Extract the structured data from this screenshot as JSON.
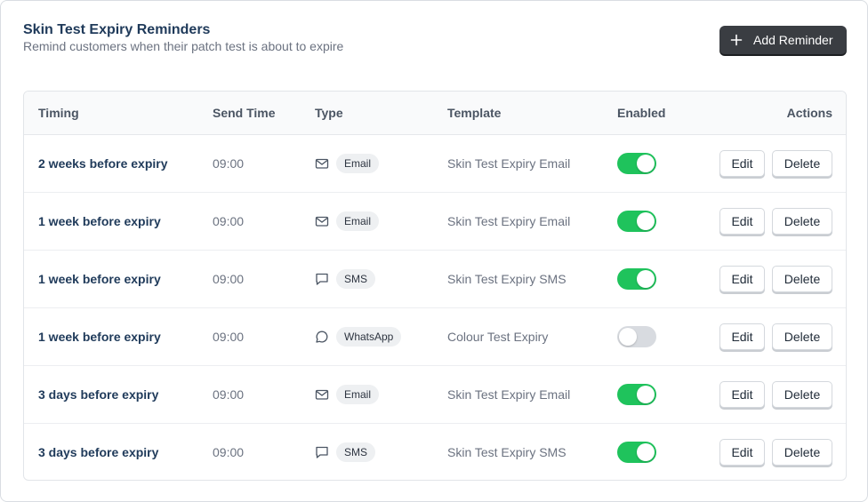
{
  "header": {
    "title": "Skin Test Expiry Reminders",
    "subtitle": "Remind customers when their patch test is about to expire",
    "add_button_label": "Add Reminder"
  },
  "table": {
    "columns": [
      "Timing",
      "Send Time",
      "Type",
      "Template",
      "Enabled",
      "Actions"
    ],
    "rows": [
      {
        "timing": "2 weeks before expiry",
        "send_time": "09:00",
        "type": "Email",
        "icon": "mail-icon",
        "template": "Skin Test Expiry Email",
        "enabled": true,
        "edit_label": "Edit",
        "delete_label": "Delete"
      },
      {
        "timing": "1 week before expiry",
        "send_time": "09:00",
        "type": "Email",
        "icon": "mail-icon",
        "template": "Skin Test Expiry Email",
        "enabled": true,
        "edit_label": "Edit",
        "delete_label": "Delete"
      },
      {
        "timing": "1 week before expiry",
        "send_time": "09:00",
        "type": "SMS",
        "icon": "message-square-icon",
        "template": "Skin Test Expiry SMS",
        "enabled": true,
        "edit_label": "Edit",
        "delete_label": "Delete"
      },
      {
        "timing": "1 week before expiry",
        "send_time": "09:00",
        "type": "WhatsApp",
        "icon": "message-circle-icon",
        "template": "Colour Test Expiry",
        "enabled": false,
        "edit_label": "Edit",
        "delete_label": "Delete"
      },
      {
        "timing": "3 days before expiry",
        "send_time": "09:00",
        "type": "Email",
        "icon": "mail-icon",
        "template": "Skin Test Expiry Email",
        "enabled": true,
        "edit_label": "Edit",
        "delete_label": "Delete"
      },
      {
        "timing": "3 days before expiry",
        "send_time": "09:00",
        "type": "SMS",
        "icon": "message-square-icon",
        "template": "Skin Test Expiry SMS",
        "enabled": true,
        "edit_label": "Edit",
        "delete_label": "Delete"
      }
    ]
  },
  "colors": {
    "toggle_on": "#1fc35c",
    "toggle_off": "#d8dbe0",
    "primary_button": "#3a3d42",
    "title_text": "#1f3a5a"
  }
}
